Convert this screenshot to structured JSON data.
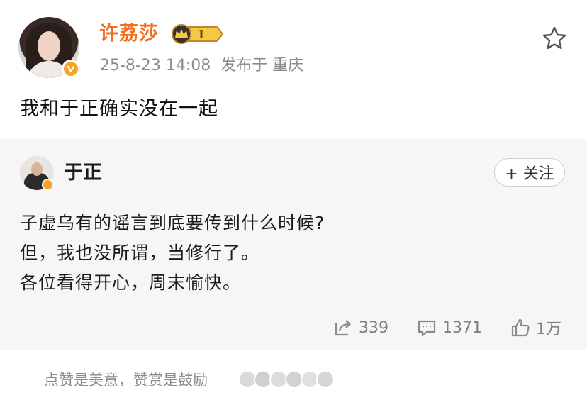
{
  "post": {
    "username": "许荔莎",
    "vip_label": "I",
    "timestamp": "25-8-23 14:08",
    "location": "发布于 重庆",
    "text": "我和于正确实没在一起"
  },
  "repost": {
    "username": "于正",
    "follow_label": "+ 关注",
    "lines": [
      "子虚乌有的谣言到底要传到什么时候?",
      "但，我也没所谓，当修行了。",
      "各位看得开心，周末愉快。"
    ],
    "share_count": "339",
    "comment_count": "1371",
    "like_count": "1万"
  },
  "footer": {
    "reward_text": "点赞是美意，赞赏是鼓励"
  },
  "colors": {
    "username": "#f36d1f",
    "verified": "#f5a623",
    "meta": "#8c8c8c",
    "repost_bg": "#f6f6f6"
  },
  "icons": [
    "star-icon",
    "verified-icon",
    "vip-crown-icon",
    "share-icon",
    "comment-icon",
    "like-icon"
  ]
}
